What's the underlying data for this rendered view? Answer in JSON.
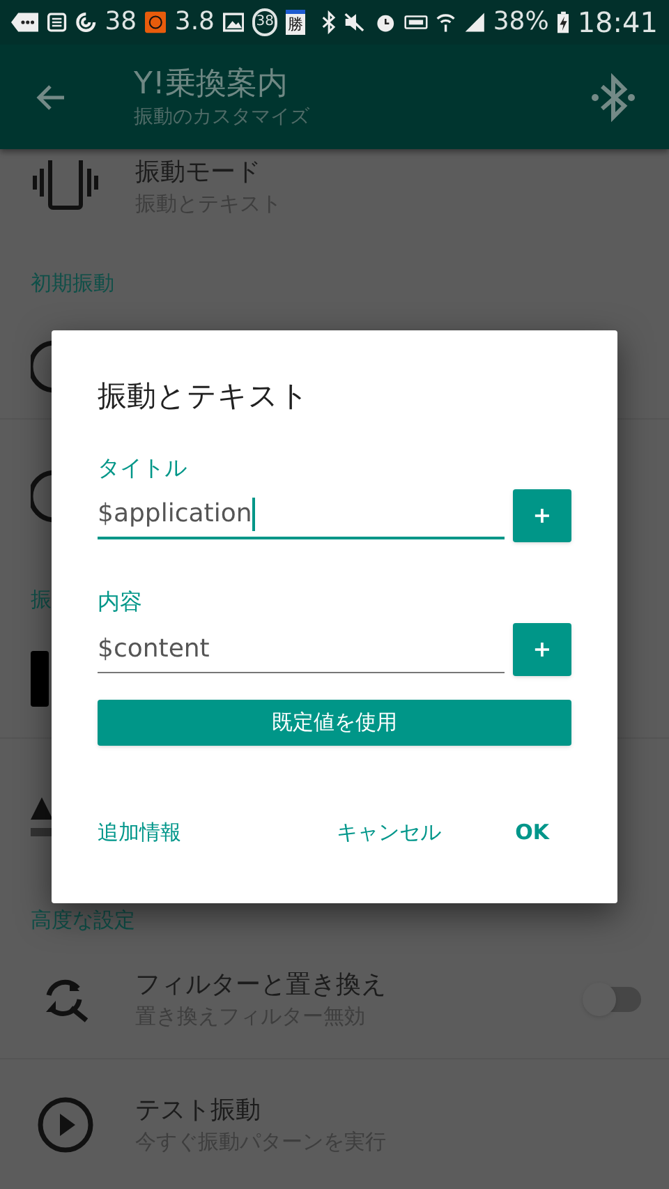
{
  "status_bar": {
    "count": "38",
    "speed": "3.8",
    "badge": "38",
    "calendar": "勝",
    "battery": "38%",
    "time": "18:41"
  },
  "app_bar": {
    "title": "Y!乗換案内",
    "subtitle": "振動のカスタマイズ"
  },
  "settings": [
    {
      "kind": "row",
      "title": "振動モード",
      "subtitle": "振動とテキスト"
    },
    {
      "kind": "header",
      "title": "初期振動"
    },
    {
      "kind": "row"
    },
    {
      "kind": "row"
    },
    {
      "kind": "header",
      "title": "振"
    },
    {
      "kind": "row"
    },
    {
      "kind": "row"
    },
    {
      "kind": "header",
      "title": "高度な設定"
    },
    {
      "kind": "switch",
      "title": "フィルターと置き換え",
      "subtitle": "置き換えフィルター無効",
      "on": false
    },
    {
      "kind": "row",
      "title": "テスト振動",
      "subtitle": "今すぐ振動パターンを実行"
    }
  ],
  "dialog": {
    "title": "振動とテキスト",
    "fields": [
      {
        "label": "タイトル",
        "value": "$application",
        "focused": true,
        "button": "+"
      },
      {
        "label": "内容",
        "value": "$content",
        "focused": false,
        "button": "+"
      }
    ],
    "default_button": "既定値を使用",
    "actions": [
      "追加情報",
      "キャンセル",
      "OK"
    ]
  }
}
